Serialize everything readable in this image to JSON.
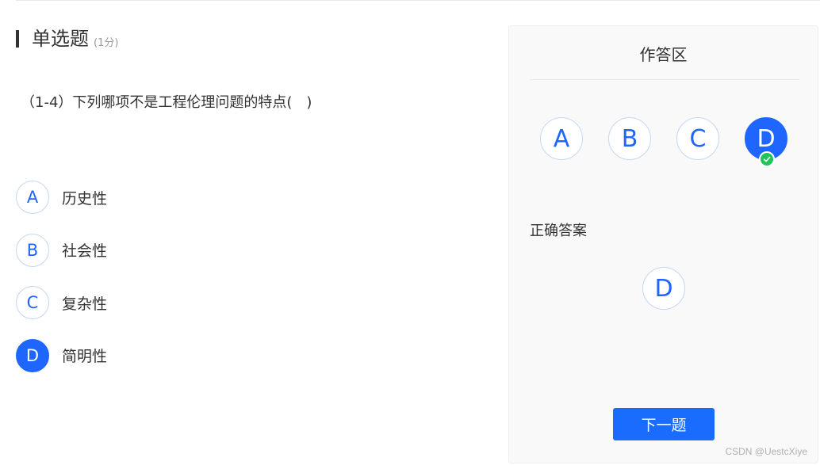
{
  "question": {
    "type_label": "单选题",
    "score_label": "(1分)",
    "text": "（1-4）下列哪项不是工程伦理问题的特点(　)",
    "options": [
      {
        "letter": "A",
        "text": "历史性"
      },
      {
        "letter": "B",
        "text": "社会性"
      },
      {
        "letter": "C",
        "text": "复杂性"
      },
      {
        "letter": "D",
        "text": "简明性"
      }
    ],
    "selected": "D"
  },
  "answer_panel": {
    "title": "作答区",
    "choices": [
      "A",
      "B",
      "C",
      "D"
    ],
    "selected": "D",
    "correct_label": "正确答案",
    "correct_answer": "D",
    "next_button": "下一题"
  },
  "watermark": "CSDN @UestcXiye",
  "colors": {
    "accent": "#1e66ff",
    "correct_badge": "#1fc45a",
    "panel_bg": "#f9f9f9",
    "text": "#333333"
  }
}
